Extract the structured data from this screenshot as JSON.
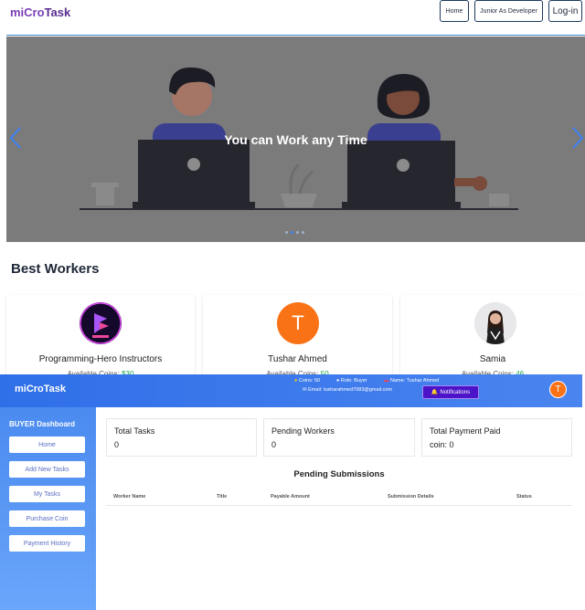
{
  "navbar": {
    "brand_part1": "miCro",
    "brand_part2": "Task",
    "buttons": {
      "home": "Home",
      "junior": "Junior As Developer",
      "login": "Log-in"
    }
  },
  "carousel": {
    "caption": "You can Work any Time",
    "dots_count": 4,
    "active_dot": 2
  },
  "best_workers": {
    "title": "Best Workers",
    "coins_label": "Available Coins:",
    "workers": [
      {
        "name": "Programming-Hero Instructors",
        "coins": "$30",
        "avatar": "logo"
      },
      {
        "name": "Tushar Ahmed",
        "coins": "50",
        "avatar": "T"
      },
      {
        "name": "Samia",
        "coins": "46",
        "avatar": "person"
      }
    ]
  },
  "dashboard": {
    "brand": "miCroTask",
    "info": {
      "coins": "Coins: 50",
      "role": "Role: Buyer",
      "name": "Name: Tushar Ahmed",
      "email": "Email: tusharahmed7083@gmail.com"
    },
    "notifications_label": "Notifications",
    "user_initial": "T",
    "sidebar": {
      "title": "BUYER Dashboard",
      "items": [
        "Home",
        "Add New Tasks",
        "My Tasks",
        "Purchase Coin",
        "Payment History"
      ]
    },
    "stats": [
      {
        "label": "Total Tasks",
        "value": "0"
      },
      {
        "label": "Pending Workers",
        "value": "0"
      },
      {
        "label": "Total Payment Paid",
        "value": "coin: 0"
      }
    ],
    "pending": {
      "title": "Pending Submissions",
      "columns": [
        "Worker Name",
        "Title",
        "Payable Amount",
        "Submission Details",
        "Status"
      ]
    }
  },
  "colors": {
    "brand": "#7a3db8",
    "dashboard_header": "#2f6fe8",
    "notification": "#4b14c8",
    "avatar_orange": "#f97316",
    "coins_green": "#16a34a"
  }
}
